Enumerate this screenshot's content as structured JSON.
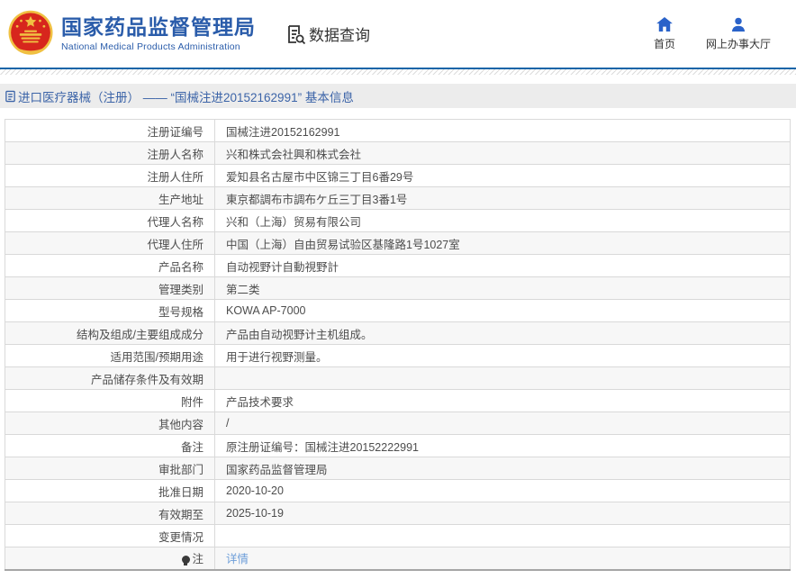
{
  "header": {
    "title_cn": "国家药品监督管理局",
    "title_en": "National Medical Products Administration",
    "nav_data_query": "数据查询",
    "nav_home": "首页",
    "nav_service_hall": "网上办事大厅"
  },
  "breadcrumb": {
    "text": "进口医疗器械（注册） —— “国械注进20152162991” 基本信息"
  },
  "table": {
    "rows": [
      {
        "label": "注册证编号",
        "value": "国械注进20152162991"
      },
      {
        "label": "注册人名称",
        "value": "兴和株式会社興和株式会社"
      },
      {
        "label": "注册人住所",
        "value": "爱知县名古屋市中区锦三丁目6番29号"
      },
      {
        "label": "生产地址",
        "value": "東京都調布市調布ケ丘三丁目3番1号"
      },
      {
        "label": "代理人名称",
        "value": "兴和（上海）贸易有限公司"
      },
      {
        "label": "代理人住所",
        "value": "中国（上海）自由贸易试验区基隆路1号1027室"
      },
      {
        "label": "产品名称",
        "value": "自动视野计自動視野計"
      },
      {
        "label": "管理类别",
        "value": "第二类"
      },
      {
        "label": "型号规格",
        "value": "KOWA AP-7000"
      },
      {
        "label": "结构及组成/主要组成成分",
        "value": "产品由自动视野计主机组成。"
      },
      {
        "label": "适用范围/预期用途",
        "value": "用于进行视野测量。"
      },
      {
        "label": "产品储存条件及有效期",
        "value": ""
      },
      {
        "label": "附件",
        "value": "产品技术要求"
      },
      {
        "label": "其他内容",
        "value": "/"
      },
      {
        "label": "备注",
        "value": "原注册证编号：国械注进20152222991"
      },
      {
        "label": "审批部门",
        "value": "国家药品监督管理局"
      },
      {
        "label": "批准日期",
        "value": "2020-10-20"
      },
      {
        "label": "有效期至",
        "value": "2025-10-19"
      },
      {
        "label": "变更情况",
        "value": ""
      },
      {
        "label": "注",
        "value": "详情",
        "label_icon": "bulb-icon",
        "value_is_link": true
      }
    ]
  },
  "colors": {
    "brand_blue": "#2a5caa",
    "rule_blue": "#1565a8",
    "icon_blue": "#2a62c9",
    "breadcrumb_bg": "#ececec",
    "breadcrumb_text": "#3c64a8",
    "link_blue": "#6d9ed9",
    "row_alt_bg": "#f7f7f7",
    "table_border": "#d9d9d9",
    "emblem_red": "#d7261d",
    "emblem_gold": "#f0c042"
  }
}
